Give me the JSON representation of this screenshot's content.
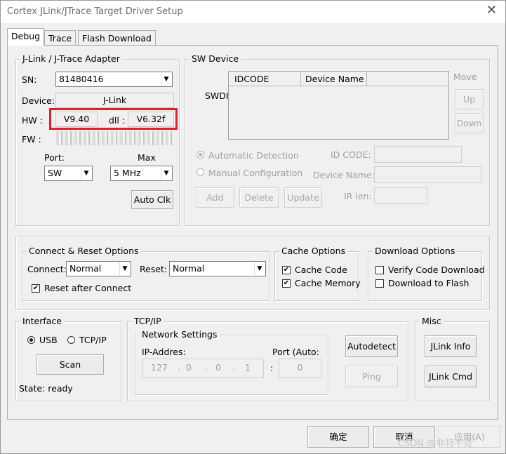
{
  "window": {
    "title": "Cortex JLink/JTrace Target Driver Setup",
    "close_glyph": "✕"
  },
  "tabs": [
    {
      "label": "Debug"
    },
    {
      "label": "Trace"
    },
    {
      "label": "Flash Download"
    }
  ],
  "adapter": {
    "group_title": "J-Link / J-Trace Adapter",
    "sn_label": "SN:",
    "sn_value": "81480416",
    "device_label": "Device:",
    "device_value": "J-Link",
    "hw_label": "HW :",
    "hw_value": "V9.40",
    "dll_label": "dll :",
    "dll_value": "V6.32f",
    "fw_label": "FW :",
    "port_label": "Port:",
    "port_value": "SW",
    "max_label": "Max",
    "max_value": "5 MHz",
    "autoclk_label": "Auto Clk"
  },
  "sw_device": {
    "group_title": "SW Device",
    "swdi_label": "SWDI",
    "columns": [
      "IDCODE",
      "Device Name"
    ],
    "move_label": "Move",
    "up_label": "Up",
    "down_label": "Down",
    "auto_detect_label": "Automatic Detection",
    "manual_config_label": "Manual Configuration",
    "id_code_label": "ID CODE:",
    "device_name_label": "Device Name:",
    "ir_len_label": "IR len:",
    "add_label": "Add",
    "delete_label": "Delete",
    "update_label": "Update"
  },
  "connect_reset": {
    "group_title": "Connect & Reset Options",
    "connect_label": "Connect:",
    "connect_value": "Normal",
    "reset_label": "Reset:",
    "reset_value": "Normal",
    "reset_after_connect_label": "Reset after Connect"
  },
  "cache_options": {
    "group_title": "Cache Options",
    "cache_code_label": "Cache Code",
    "cache_memory_label": "Cache Memory"
  },
  "download_options": {
    "group_title": "Download Options",
    "verify_label": "Verify Code Download",
    "download_flash_label": "Download to Flash"
  },
  "interface": {
    "group_title": "Interface",
    "usb_label": "USB",
    "tcpip_label": "TCP/IP",
    "scan_label": "Scan",
    "state_text": "State: ready"
  },
  "tcpip": {
    "group_title": "TCP/IP",
    "network_title": "Network Settings",
    "ip_label": "IP-Addres:",
    "ip": [
      "127",
      "0",
      "0",
      "1"
    ],
    "port_label": "Port (Auto:",
    "port_value": "0",
    "autodetect_label": "Autodetect",
    "ping_label": "Ping"
  },
  "misc": {
    "group_title": "Misc",
    "jlink_info_label": "JLink Info",
    "jlink_cmd_label": "JLink Cmd"
  },
  "footer": {
    "ok_label": "确定",
    "cancel_label": "取消",
    "apply_label": "应用(A)"
  },
  "watermark": "CSDN @非特不克"
}
